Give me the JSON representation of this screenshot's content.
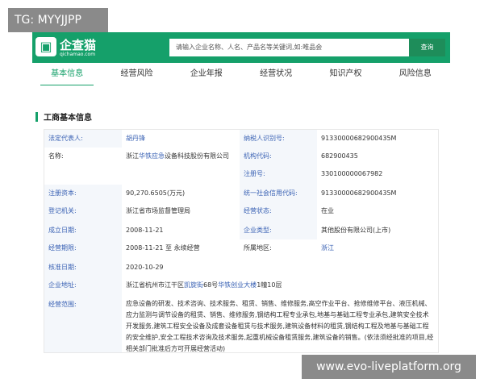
{
  "overlay": {
    "top_tag": "TG: MYYJJPP",
    "bottom_url": "www.evo-liveplatform.org"
  },
  "header": {
    "logo_text": "企查猫",
    "logo_sub": "qichamao.com",
    "search_placeholder": "请输入企业名称、人名、产品名等关键词,如:唯品会",
    "search_button": "查询",
    "brand_color": "#15a06a"
  },
  "tabs": [
    {
      "label": "基本信息",
      "active": true
    },
    {
      "label": "经营风险",
      "active": false
    },
    {
      "label": "企业年报",
      "active": false
    },
    {
      "label": "经营状况",
      "active": false
    },
    {
      "label": "知识产权",
      "active": false
    },
    {
      "label": "风险信息",
      "active": false
    }
  ],
  "section": {
    "title": "工商基本信息"
  },
  "info": {
    "legal_rep_label": "法定代表人:",
    "legal_rep_value": "胡丹锋",
    "taxpayer_id_label": "纳税人识别号:",
    "taxpayer_id_value": "91330000682900435M",
    "name_label": "名称:",
    "name_prefix": "浙江",
    "name_highlight": "华铁应急",
    "name_suffix": "设备科技股份有限公司",
    "org_code_label": "机构代码:",
    "org_code_value": "682900435",
    "reg_no_label": "注册号:",
    "reg_no_value": "330100000067982",
    "capital_label": "注册资本:",
    "capital_value": "90,270.6505(万元)",
    "credit_code_label": "统一社会信用代码:",
    "credit_code_value": "91330000682900435M",
    "authority_label": "登记机关:",
    "authority_value": "浙江省市场监督管理局",
    "status_label": "经营状态:",
    "status_value": "在业",
    "founded_label": "成立日期:",
    "founded_value": "2008-11-21",
    "type_label": "企业类型:",
    "type_value": "其他股份有限公司(上市)",
    "term_label": "经营期限:",
    "term_value": "2008-11-21 至 永续经营",
    "region_label": "所属地区:",
    "region_value": "浙江",
    "approved_label": "核准日期:",
    "approved_value": "2020-10-29",
    "address_label": "企业地址:",
    "address_part1": "浙江省杭州市江干区",
    "address_part2": "凯旋街",
    "address_part3": "68号",
    "address_part4": "华铁创业大楼",
    "address_part5": "1幢10层",
    "scope_label": "经营范围:",
    "scope_value": "应急设备的研发、技术咨询、技术服务、租赁、销售、维修服务,高空作业平台、抢修维修平台、液压机械、应力监测与调节设备的租赁、销售、维修服务,钢结构工程专业承包,地基与基础工程专业承包,建筑安全技术开发服务,建筑工程安全设备及成套设备租赁与技术服务,建筑设备材料的租赁,钢结构工程及地基与基础工程的安全维护,安全工程技术咨询及技术服务,起重机械设备租赁服务,建筑设备的销售。(依法须经批准的项目,经相关部门批准后方可开展经营活动)"
  }
}
